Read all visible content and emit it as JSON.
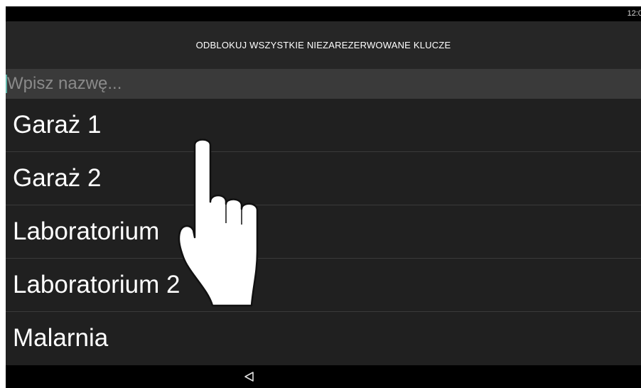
{
  "status_bar": {
    "time": "12:0"
  },
  "action_bar": {
    "button_label": "ODBLOKUJ WSZYSTKIE NIEZAREZERWOWANE KLUCZE"
  },
  "search": {
    "placeholder": "Wpisz nazwę...",
    "value": ""
  },
  "list": {
    "items": [
      {
        "label": "Garaż 1"
      },
      {
        "label": "Garaż 2"
      },
      {
        "label": "Laboratorium"
      },
      {
        "label": "Laboratorium 2"
      },
      {
        "label": "Malarnia"
      }
    ]
  },
  "nav_bar": {
    "back_icon": "back-triangle-icon"
  },
  "overlay": {
    "icon": "pointing-hand-icon"
  },
  "colors": {
    "background": "#202020",
    "action_bar": "#262626",
    "search_bar": "#3a3a3a",
    "accent": "#5fb3a8",
    "text": "#ffffff"
  }
}
